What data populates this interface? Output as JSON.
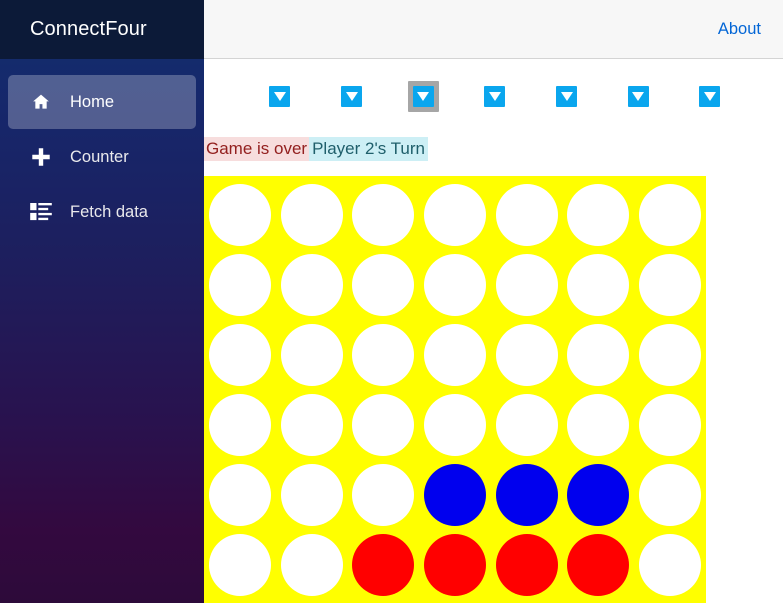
{
  "app": {
    "brand": "ConnectFour"
  },
  "topbar": {
    "about_label": "About"
  },
  "sidebar": {
    "items": [
      {
        "label": "Home",
        "icon": "home-icon",
        "active": true
      },
      {
        "label": "Counter",
        "icon": "plus-icon",
        "active": false
      },
      {
        "label": "Fetch data",
        "icon": "list-icon",
        "active": false
      }
    ]
  },
  "game": {
    "status_game_over": "Game is over",
    "status_turn": "Player 2's Turn",
    "columns": 7,
    "rows": 6,
    "drop_button_icon": "chevron-down-icon",
    "focused_column_index": 2,
    "colors": {
      "board": "#ffff00",
      "empty": "#ffffff",
      "player1": "#ff0000",
      "player2": "#0000ee",
      "drop_button": "#0aa6ee",
      "focus_plate": "#a6a6a6",
      "brand_bar": "#0c1a38",
      "link": "#0366d6"
    },
    "grid": [
      [
        "empty",
        "empty",
        "empty",
        "empty",
        "empty",
        "empty",
        "empty"
      ],
      [
        "empty",
        "empty",
        "empty",
        "empty",
        "empty",
        "empty",
        "empty"
      ],
      [
        "empty",
        "empty",
        "empty",
        "empty",
        "empty",
        "empty",
        "empty"
      ],
      [
        "empty",
        "empty",
        "empty",
        "empty",
        "empty",
        "empty",
        "empty"
      ],
      [
        "empty",
        "empty",
        "empty",
        "player2",
        "player2",
        "player2",
        "empty"
      ],
      [
        "empty",
        "empty",
        "player1",
        "player1",
        "player1",
        "player1",
        "empty"
      ]
    ]
  }
}
